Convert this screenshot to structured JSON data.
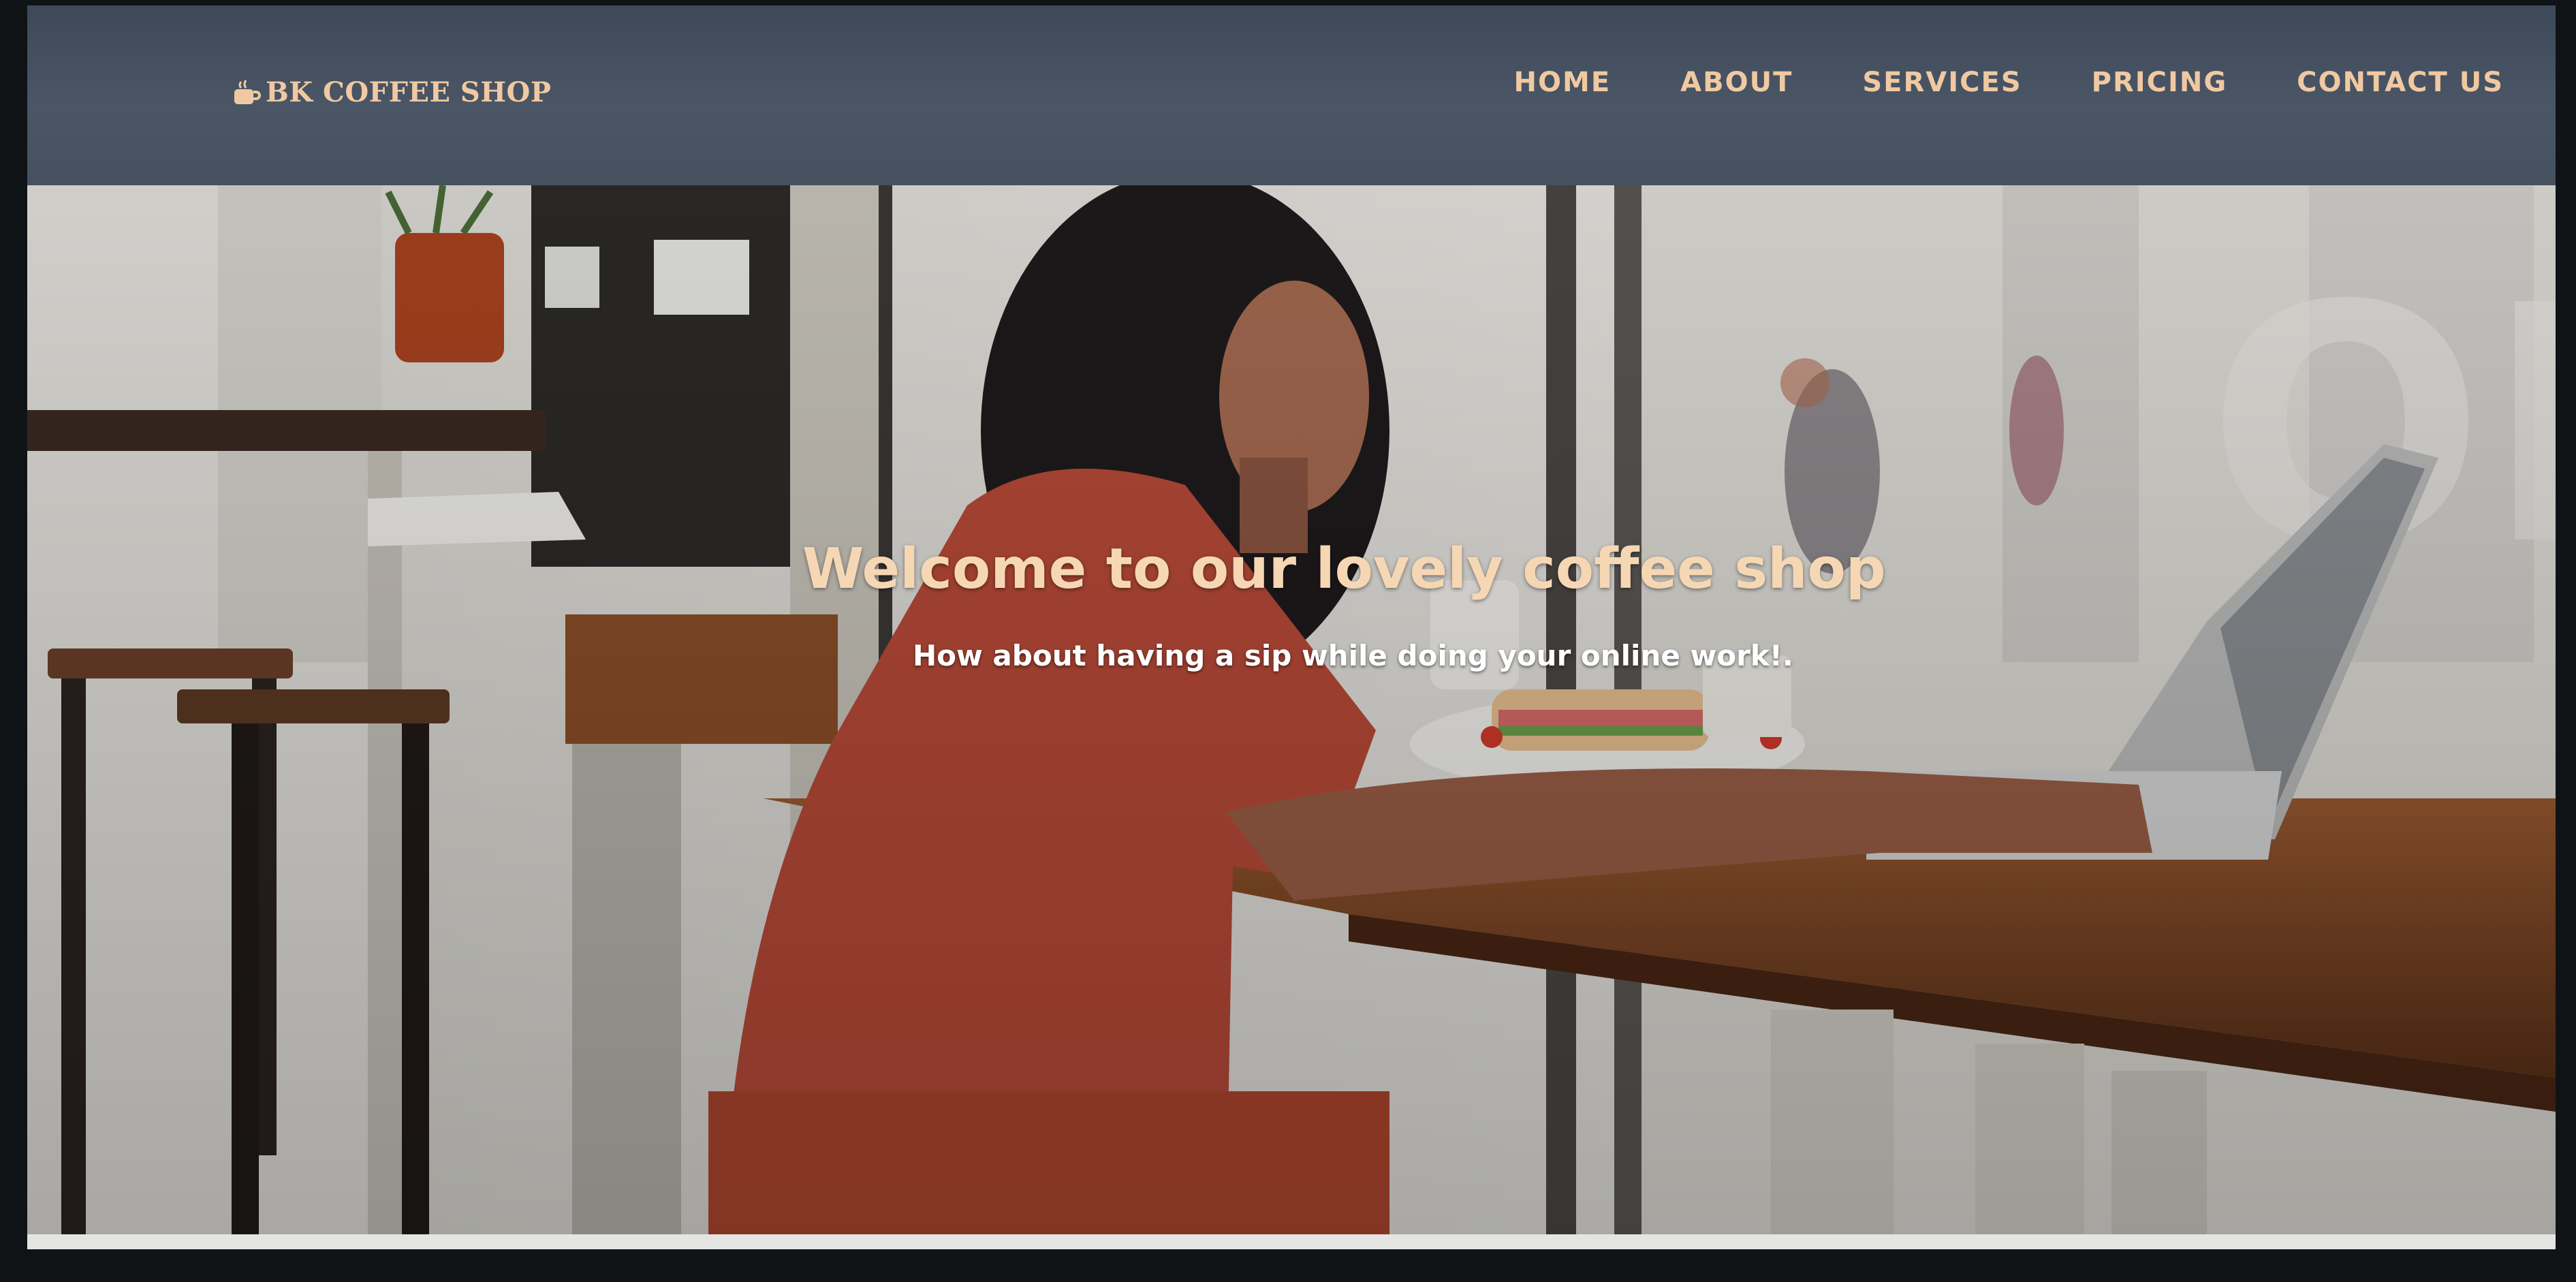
{
  "brand": {
    "name": "BK COFFEE SHOP",
    "icon": "coffee-cup-icon",
    "color": "#f0c9a2"
  },
  "nav": {
    "items": [
      {
        "label": "HOME"
      },
      {
        "label": "ABOUT"
      },
      {
        "label": "SERVICES"
      },
      {
        "label": "PRICING"
      },
      {
        "label": "CONTACT US"
      }
    ]
  },
  "hero": {
    "title": "Welcome to our lovely coffee shop",
    "subtitle": "How about having a sip while doing your online work!."
  },
  "colors": {
    "navbar": "#46515f",
    "accent": "#f0c9a2",
    "title": "#f6d7b4"
  }
}
